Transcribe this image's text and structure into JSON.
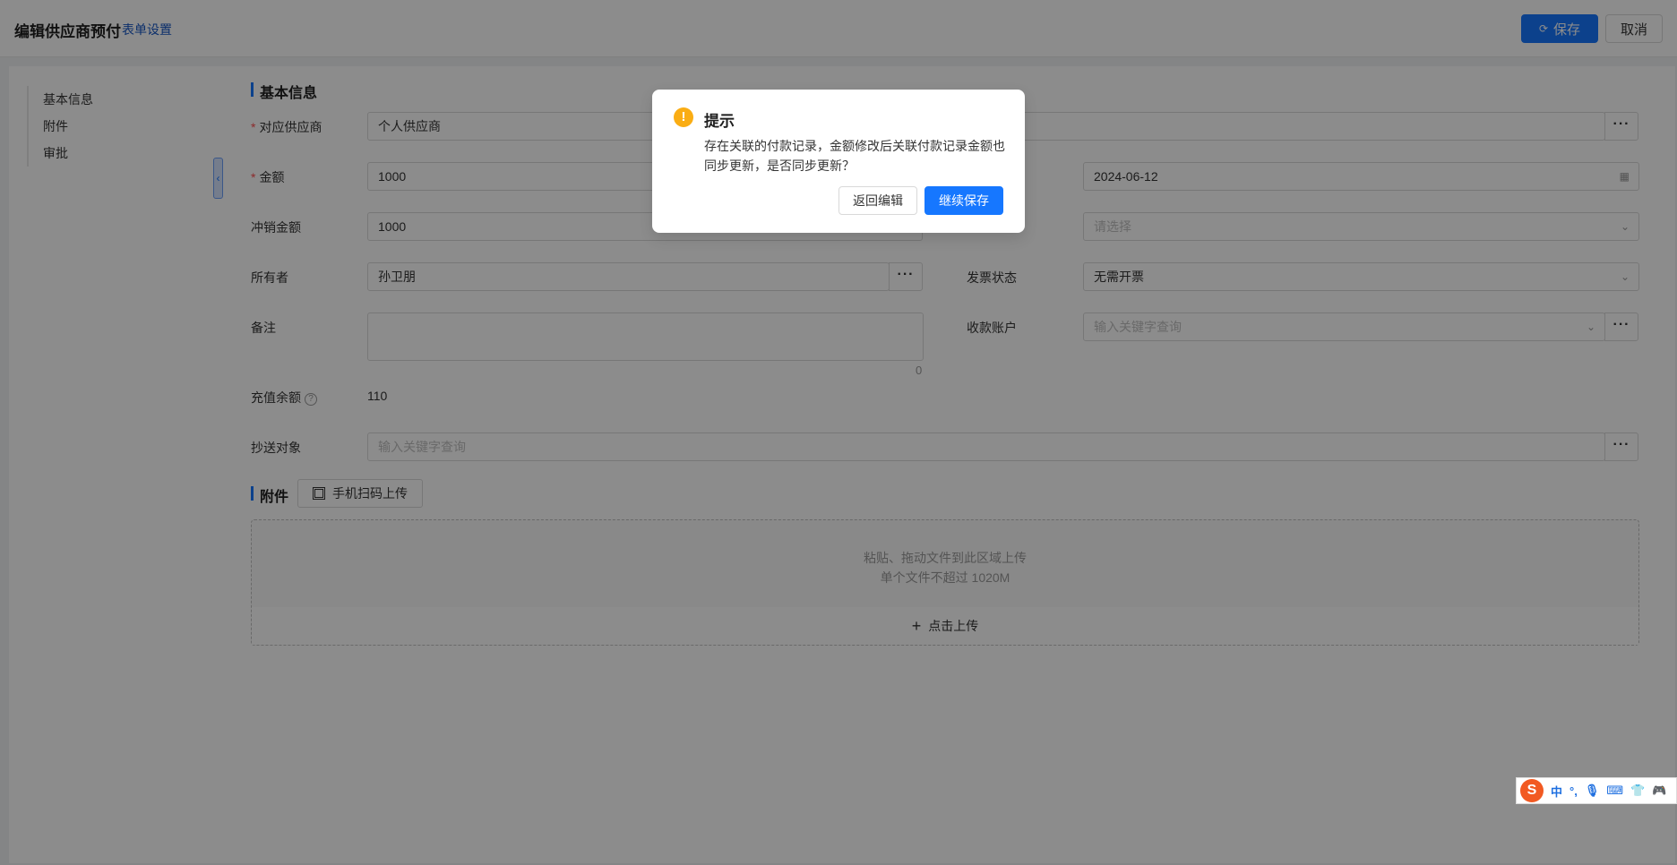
{
  "header": {
    "title": "编辑供应商预付",
    "form_settings": "表单设置",
    "save_label": "保存",
    "cancel_label": "取消"
  },
  "side_nav": {
    "items": [
      "基本信息",
      "附件",
      "审批"
    ]
  },
  "basic_info": {
    "section_title": "基本信息",
    "supplier": {
      "label": "对应供应商",
      "value": "个人供应商"
    },
    "amount": {
      "label": "金额",
      "value": "1000"
    },
    "date": {
      "value": "2024-06-12"
    },
    "offset_amount": {
      "label": "冲销金额",
      "value": "1000"
    },
    "select_placeholder": "请选择",
    "owner": {
      "label": "所有者",
      "value": "孙卫朋"
    },
    "invoice_status": {
      "label": "发票状态",
      "value": "无需开票"
    },
    "remark": {
      "label": "备注",
      "counter": "0"
    },
    "receiving_account": {
      "label": "收款账户",
      "placeholder": "输入关键字查询"
    },
    "recharge_balance": {
      "label": "充值余额",
      "value": "110"
    },
    "cc": {
      "label": "抄送对象",
      "placeholder": "输入关键字查询"
    }
  },
  "attachments": {
    "section_title": "附件",
    "qr_upload_label": "手机扫码上传",
    "drop_hint_line1": "粘贴、拖动文件到此区域上传",
    "drop_hint_line2": "单个文件不超过 1020M",
    "upload_label": "点击上传"
  },
  "modal": {
    "title": "提示",
    "message": "存在关联的付款记录，金额修改后关联付款记录金额也同步更新，是否同步更新？",
    "back_label": "返回编辑",
    "continue_label": "继续保存"
  },
  "ime": {
    "logo": "S",
    "mode": "中",
    "punct": "°,"
  },
  "colors": {
    "primary": "#1677ff",
    "warning": "#faad14",
    "required": "#ff4d4f"
  }
}
